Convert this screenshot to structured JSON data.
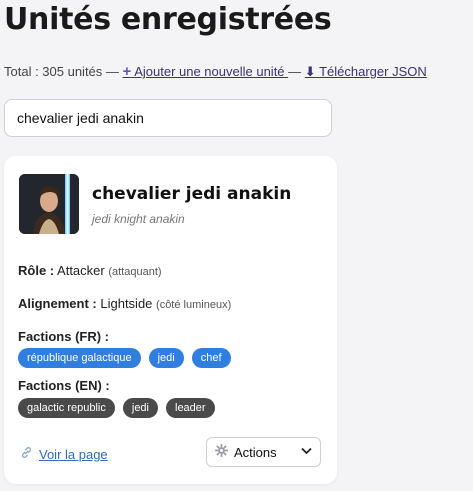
{
  "header": {
    "title": "Unités enregistrées"
  },
  "summary": {
    "total_text": "Total : 305 unités —",
    "add_icon": "+",
    "add_label": "Ajouter une nouvelle unité",
    "separator": "—",
    "download_icon": "⬇",
    "download_label": "Télécharger JSON"
  },
  "search": {
    "value": "chevalier jedi anakin"
  },
  "card": {
    "avatar_icon": "character-portrait",
    "name": "chevalier jedi anakin",
    "subtitle": "jedi knight anakin",
    "role_label": "Rôle :",
    "role_value": "Attacker",
    "role_fr": "(attaquant)",
    "alignment_label": "Alignement :",
    "alignment_value": "Lightside",
    "alignment_fr": "(côté lumineux)",
    "factions_fr_label": "Factions (FR) :",
    "factions_fr": [
      "république galactique",
      "jedi",
      "chef"
    ],
    "factions_en_label": "Factions (EN) :",
    "factions_en": [
      "galactic republic",
      "jedi",
      "leader"
    ],
    "link_label": "Voir la page",
    "actions_label": "Actions",
    "colors": {
      "tag_fr": "#2f7ee0",
      "tag_en": "#4a4a4a",
      "link": "#2f6db8"
    }
  }
}
